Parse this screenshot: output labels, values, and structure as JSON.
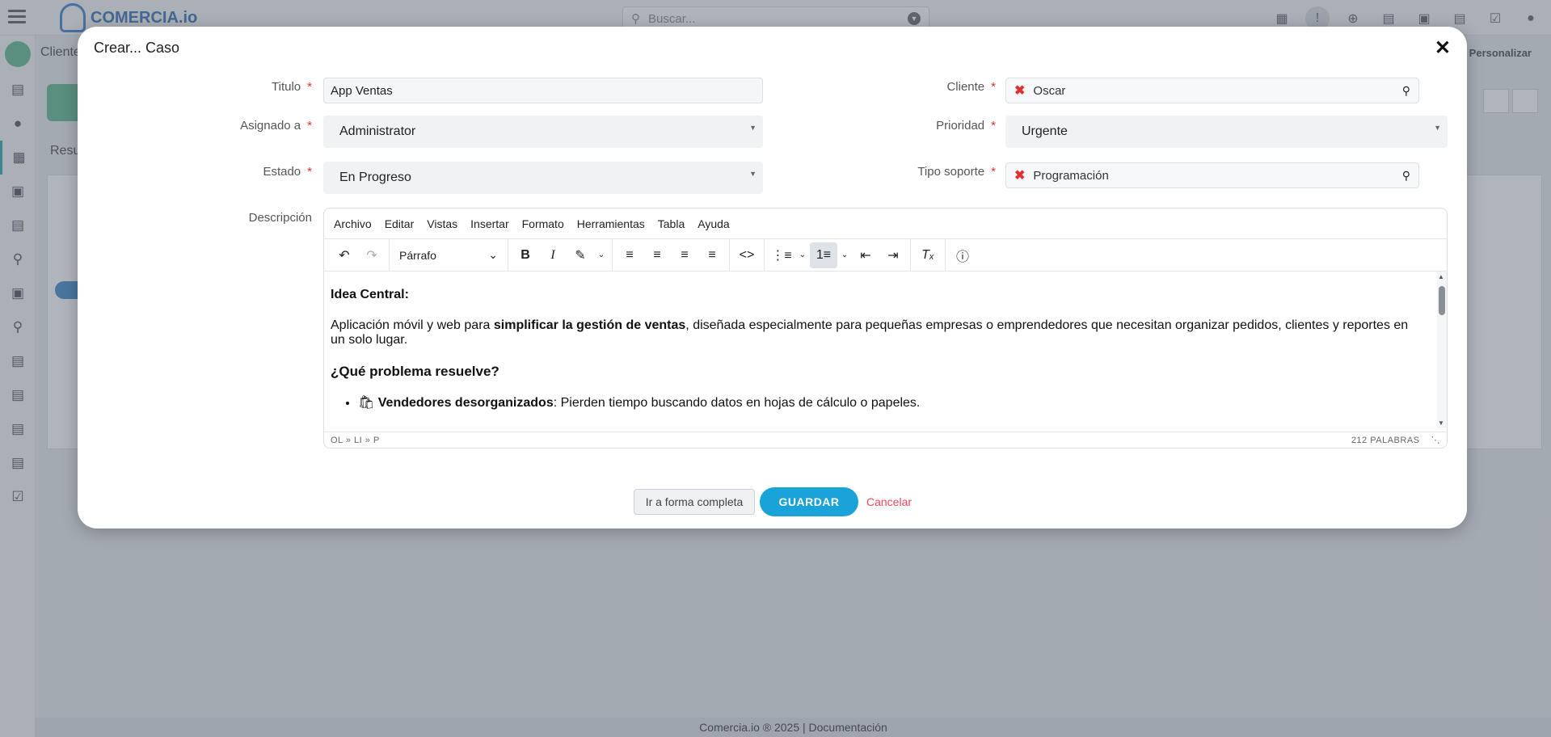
{
  "app": {
    "logo_text": "COMERCIA.io",
    "search_placeholder": "Buscar...",
    "breadcrumb": "Cliente",
    "personalize": "Personalizar",
    "bg_tab": "Resu",
    "footer_text": "Comercia.io ® 2025  |",
    "footer_link": "Documentación"
  },
  "modal": {
    "title": "Crear... Caso",
    "close": "✕",
    "fields": {
      "titulo_label": "Titulo",
      "titulo_value": "App Ventas",
      "asignado_label": "Asignado a",
      "asignado_value": "Administrator",
      "estado_label": "Estado",
      "estado_value": "En Progreso",
      "cliente_label": "Cliente",
      "cliente_value": "Oscar",
      "prioridad_label": "Prioridad",
      "prioridad_value": "Urgente",
      "tipo_label": "Tipo soporte",
      "tipo_value": "Programación",
      "descripcion_label": "Descripción"
    },
    "editor": {
      "menu": [
        "Archivo",
        "Editar",
        "Vistas",
        "Insertar",
        "Formato",
        "Herramientas",
        "Tabla",
        "Ayuda"
      ],
      "block_format": "Párrafo",
      "content": {
        "h1": "Idea Central",
        "h1_colon": ":",
        "p1_a": "Aplicación móvil y web para ",
        "p1_b": "simplificar la gestión de ventas",
        "p1_c": ", diseñada especialmente para pequeñas empresas o emprendedores que necesitan organizar pedidos, clientes y reportes en un solo lugar.",
        "h2": "¿Qué problema resuelve?",
        "li1_icon": "🛍",
        "li1_b": "Vendedores desorganizados",
        "li1_c": ": Pierden tiempo buscando datos en hojas de cálculo o papeles."
      },
      "path": "OL » LI » P",
      "word_count": "212 PALABRAS"
    },
    "buttons": {
      "full_form": "Ir a forma completa",
      "save": "GUARDAR",
      "cancel": "Cancelar"
    }
  }
}
